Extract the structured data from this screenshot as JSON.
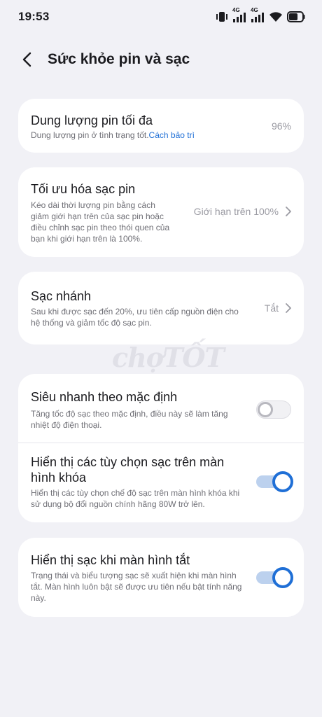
{
  "status_bar": {
    "time": "19:53",
    "network1": "4G",
    "network2": "4G",
    "icons": [
      "vibrate-icon",
      "signal-icon",
      "signal-icon",
      "wifi-icon",
      "battery-icon"
    ]
  },
  "header": {
    "title": "Sức khỏe pin và sạc",
    "back_icon": "back-arrow-icon"
  },
  "max_capacity": {
    "title": "Dung lượng pin tối đa",
    "desc": "Dung lượng pin ở tình trạng tốt.",
    "link": "Cách bảo trì",
    "value": "96%"
  },
  "optimize_charging": {
    "title": "Tối ưu hóa sạc pin",
    "desc_lines": [
      "Kéo dài thời lượng pin bằng cách",
      "giảm giới hạn trên của sạc pin hoặc",
      "điều chỉnh sạc pin theo thói quen của",
      "bạn khi giới hạn trên là 100%."
    ],
    "value": "Giới hạn trên 100%"
  },
  "fast_charging": {
    "title": "Sạc nhánh",
    "desc_lines": [
      "Sau khi được sạc đến 20%, ưu tiên cấp nguồn điện cho",
      "hệ thống và giảm tốc độ sạc pin."
    ],
    "value": "Tắt"
  },
  "super_fast": {
    "title": "Siêu nhanh theo mặc định",
    "desc_lines": [
      "Tăng tốc độ sạc theo mặc định, điều này sẽ làm tăng",
      "nhiệt độ điện thoại."
    ],
    "enabled": false
  },
  "lockscreen_options": {
    "title_lines": [
      "Hiển thị các tùy chọn sạc trên màn",
      "hình khóa"
    ],
    "desc_lines": [
      "Hiển thị các tùy chọn chế độ sạc trên màn hình khóa khi",
      "sử dụng bộ đổi nguồn chính hãng 80W trở lên."
    ],
    "enabled": true
  },
  "screen_off_charging": {
    "title": "Hiển thị sạc khi màn hình tắt",
    "desc_lines": [
      "Trạng thái và biểu tượng sạc sẽ xuất hiện khi màn hình",
      "tắt. Màn hình luôn bật sẽ được ưu tiên nếu bật tính năng",
      "này."
    ],
    "enabled": true
  },
  "watermark": "chợTỐT",
  "colors": {
    "accent": "#1f6fd6",
    "background": "#f1f1f6",
    "card": "#ffffff"
  }
}
